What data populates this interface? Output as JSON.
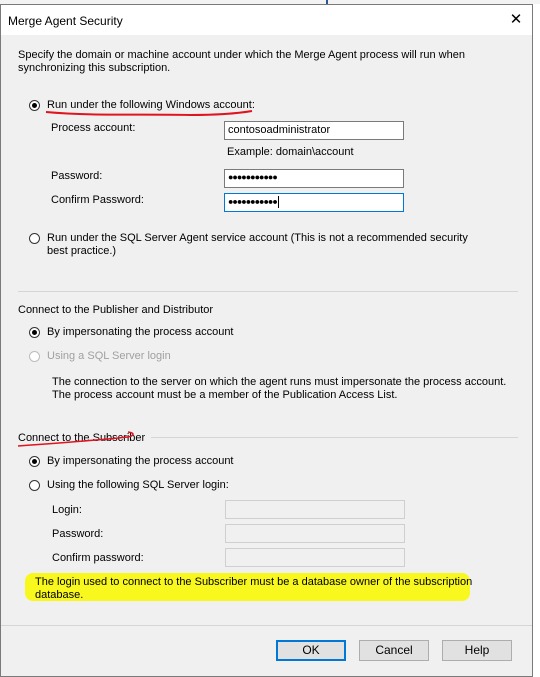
{
  "dialog": {
    "title": "Merge Agent Security",
    "close_glyph": "✕",
    "intro": "Specify the domain or machine account under which the Merge Agent process will run when synchronizing this subscription."
  },
  "windows_account": {
    "radio_label": "Run under the following Windows account:",
    "selected": true,
    "process_account_label": "Process account:",
    "process_account_value": "contosoadministrator",
    "example": "Example: domain\\account",
    "password_label": "Password:",
    "password_value": "●●●●●●●●●●●",
    "confirm_label": "Confirm Password:",
    "confirm_value": "●●●●●●●●●●●"
  },
  "agent_service": {
    "radio_label": "Run under the SQL Server Agent service account (This is not a recommended security best practice.)",
    "selected": false
  },
  "publisher": {
    "heading": "Connect to the Publisher and Distributor",
    "impersonate_label": "By impersonating the process account",
    "sql_login_label": "Using a SQL Server login",
    "note": "The connection to the server on which the agent runs must impersonate the process account. The process account must be a member of the Publication Access List."
  },
  "subscriber": {
    "heading": "Connect to the Subscriber",
    "impersonate_label": "By impersonating the process account",
    "sql_login_label": "Using the following SQL Server login:",
    "login_label": "Login:",
    "password_label": "Password:",
    "confirm_label": "Confirm password:",
    "note": "The login used to connect to the Subscriber must be a database owner of the subscription database."
  },
  "buttons": {
    "ok": "OK",
    "cancel": "Cancel",
    "help": "Help"
  },
  "colors": {
    "accent": "#0078d7",
    "highlight": "#f9f81e",
    "ink": "#e0141e"
  }
}
